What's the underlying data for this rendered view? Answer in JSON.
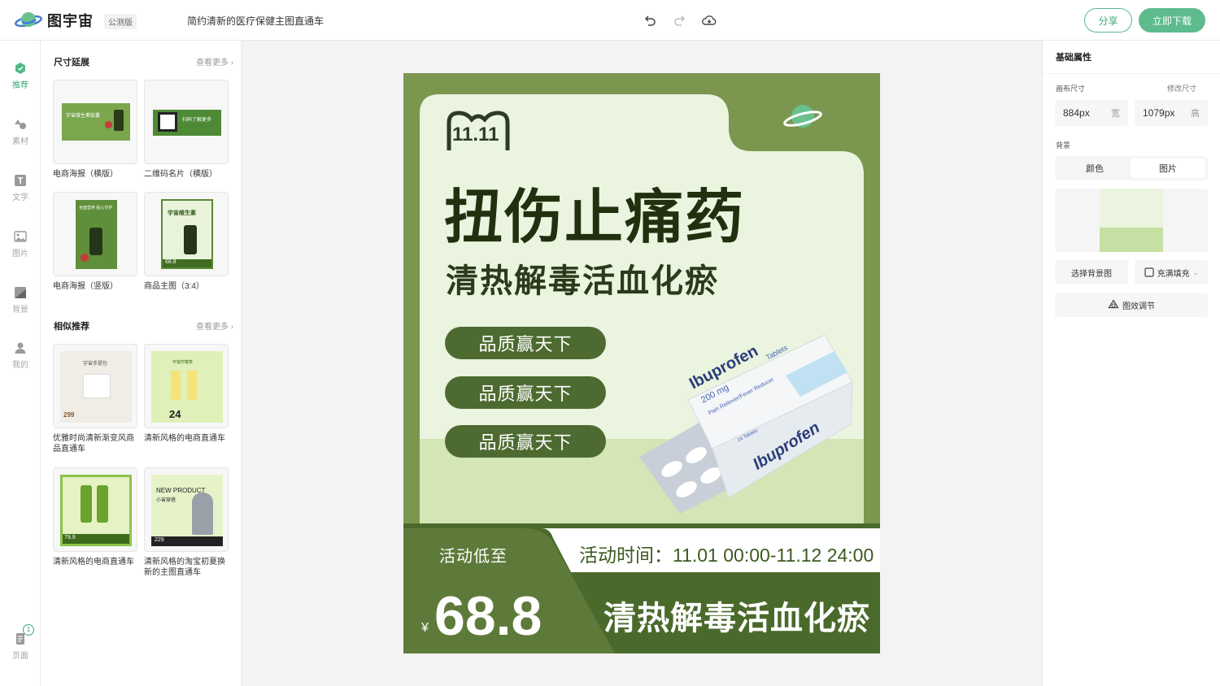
{
  "header": {
    "logo_text": "图宇宙",
    "beta_badge": "公测版",
    "doc_title": "简约清新的医疗保健主图直通车",
    "share_label": "分享",
    "download_label": "立即下载",
    "icons": [
      "undo-icon",
      "redo-icon",
      "cloud-save-icon"
    ]
  },
  "rail": {
    "items": [
      {
        "label": "推荐",
        "icon": "recommend-icon"
      },
      {
        "label": "素材",
        "icon": "material-icon"
      },
      {
        "label": "文字",
        "icon": "text-icon"
      },
      {
        "label": "图片",
        "icon": "image-icon"
      },
      {
        "label": "背景",
        "icon": "background-icon"
      },
      {
        "label": "我的",
        "icon": "user-icon"
      }
    ],
    "page_label": "页面",
    "page_count": "1"
  },
  "panel": {
    "section1_title": "尺寸延展",
    "section1_more": "查看更多",
    "size_templates": [
      {
        "caption": "电商海报（横版）",
        "thumb_text": "宇宙维生素胶囊"
      },
      {
        "caption": "二维码名片（横版）",
        "thumb_text": "扫码了解更多"
      },
      {
        "caption": "电商海报（竖版）",
        "thumb_text": "全面营养 贴心守护"
      },
      {
        "caption": "商品主图（3:4）",
        "thumb_text": "宇宙维生素",
        "price": "68.8"
      }
    ],
    "section2_title": "相似推荐",
    "section2_more": "查看更多",
    "similar_templates": [
      {
        "caption": "优雅时尚清新渐变风商品直通车",
        "thumb_text": "宇宙手提包",
        "price": "299"
      },
      {
        "caption": "清新风格的电商直通车",
        "thumb_text": "宇宙柠檬茶",
        "price": "24"
      },
      {
        "caption": "清新风格的电商直通车",
        "thumb_text": "",
        "price": "79.9"
      },
      {
        "caption": "清新风格的淘宝初夏换新的主图直通车",
        "thumb_text": "NEW PRODUCT",
        "sub_text": "小宙穿搭",
        "price": "229"
      }
    ]
  },
  "poster": {
    "brand_mark": "11.11",
    "headline": "扭伤止痛药",
    "subheadline": "清热解毒活血化瘀",
    "pills": [
      "品质赢天下",
      "品质赢天下",
      "品质赢天下"
    ],
    "product_name": "Ibuprofen",
    "product_dose": "200 mg",
    "product_desc": "Pain Reliever/Fever Reducer",
    "product_tablets": "Tablets",
    "product_count": "24 Tablets",
    "promo_label": "活动低至",
    "promo_time": "活动时间：11.01 00:00-11.12 24:00",
    "currency": "¥",
    "price": "68.8",
    "footer_slogan": "清热解毒活血化瘀",
    "colors": {
      "dark_green": "#3d5a1e",
      "mid_green": "#7b964f",
      "light_green": "#eaf4df",
      "pale_green": "#d4e6b5"
    }
  },
  "props": {
    "title": "基础属性",
    "canvas_size_label": "画布尺寸",
    "resize_label": "修改尺寸",
    "width_value": "884px",
    "width_unit": "宽",
    "height_value": "1079px",
    "height_unit": "高",
    "background_label": "背景",
    "tab_color": "颜色",
    "tab_image": "图片",
    "choose_bg_label": "选择背景图",
    "fill_mode_label": "充满填充",
    "effect_label": "图效调节"
  }
}
